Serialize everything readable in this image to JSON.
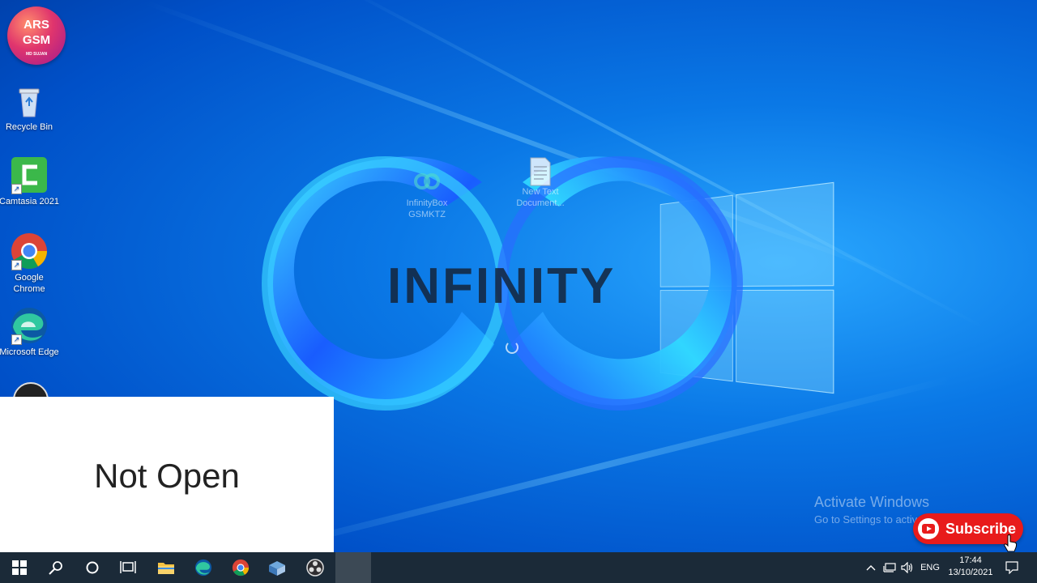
{
  "channel_logo": {
    "line1": "ARS",
    "line2": "GSM",
    "line3": "MD SUJAN"
  },
  "desktop_icons": [
    {
      "name": "recycle-bin",
      "label": "Recycle Bin"
    },
    {
      "name": "camtasia",
      "label": "Camtasia 2021"
    },
    {
      "name": "google-chrome",
      "label": "Google Chrome"
    },
    {
      "name": "microsoft-edge",
      "label": "Microsoft Edge"
    }
  ],
  "ghost_icons": [
    {
      "label": "InfinityBox GSMKTZ"
    },
    {
      "label": "New Text Document..."
    }
  ],
  "overlay_logo_text": "INFINITY",
  "caption": "Not Open",
  "watermark": {
    "title": "Activate Windows",
    "subtitle": "Go to Settings to activate Windows."
  },
  "subscribe": {
    "label": "Subscribe"
  },
  "taskbar": {
    "buttons": [
      "start-icon",
      "search-icon",
      "cortana-icon",
      "task-view-icon",
      "file-explorer-icon",
      "edge-icon",
      "chrome-icon",
      "infinity-box-icon",
      "obs-icon"
    ],
    "tray": {
      "language": "ENG",
      "time": "17:44",
      "date": "13/10/2021"
    }
  },
  "colors": {
    "desktop": "#0a78e6",
    "taskbar": "#1b2a38",
    "subscribe": "#e81b1b"
  }
}
